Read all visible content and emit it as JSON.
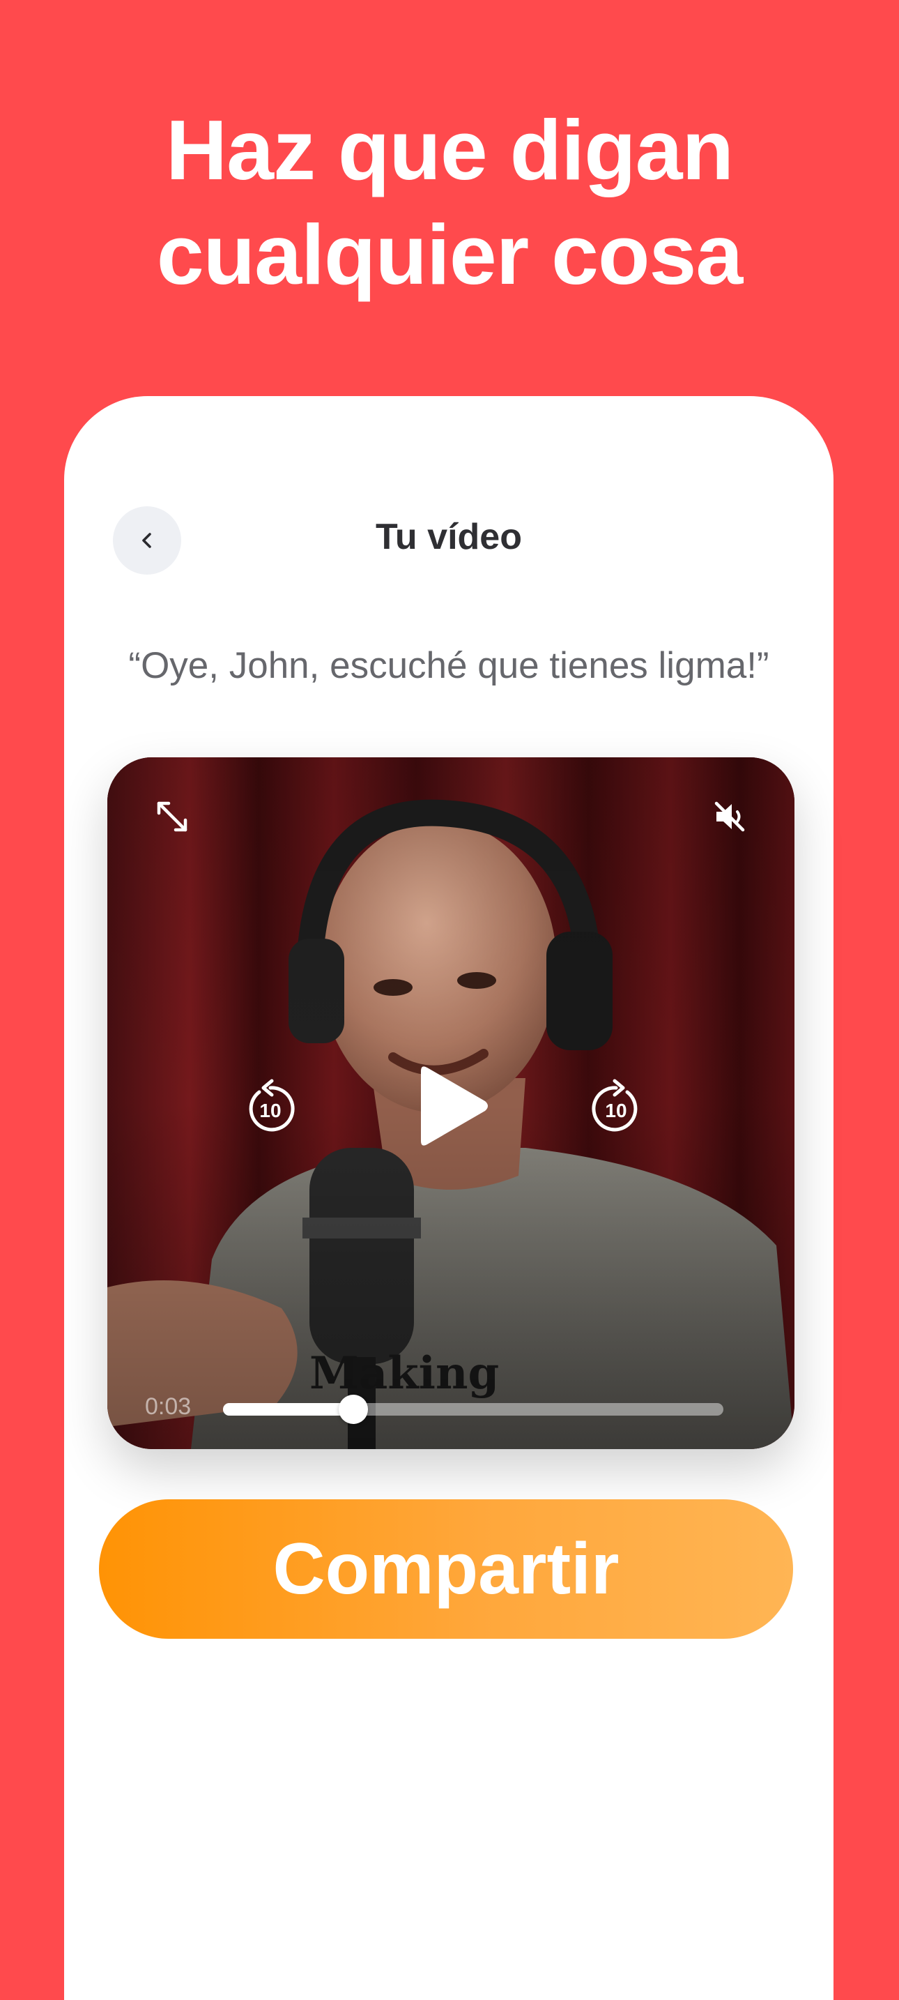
{
  "headline": {
    "line1": "Haz que digan",
    "line2": "cualquier cosa"
  },
  "screen": {
    "title": "Tu vídeo",
    "back_icon": "chevron-left-icon",
    "quote": "“Oye, John, escuché que tienes ligma!”"
  },
  "player": {
    "current_time": "0:03",
    "progress": 0.26,
    "icons": {
      "expand": "expand-arrows-icon",
      "mute": "speaker-muted-icon",
      "rewind": "rewind-10-icon",
      "play": "play-icon",
      "forward": "forward-10-icon"
    },
    "rewind_label": "10",
    "forward_label": "10"
  },
  "share_button": {
    "label": "Compartir"
  },
  "colors": {
    "background": "#ff4a4d",
    "button_gradient_start": "#ff9305",
    "button_gradient_end": "#ffb554",
    "title_text": "#2f2f33",
    "quote_text": "#66676c"
  }
}
